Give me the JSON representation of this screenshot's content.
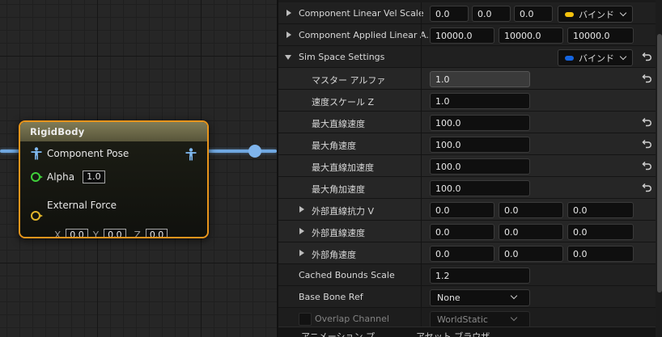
{
  "node": {
    "title": "RigidBody",
    "pose_label": "Component Pose",
    "alpha_label": "Alpha",
    "alpha_value": "1.0",
    "force_label": "External Force",
    "x_label": "X",
    "x_value": "0.0",
    "y_label": "Y",
    "y_value": "0.0",
    "z_label": "Z",
    "z_value": "0.0"
  },
  "details": {
    "rows": {
      "linear_vel_scale": {
        "label": "Component Linear Vel Scale",
        "v1": "0.0",
        "v2": "0.0",
        "v3": "0.0"
      },
      "applied_linear": {
        "label": "Component Applied Linear A...",
        "v1": "10000.0",
        "v2": "10000.0",
        "v3": "10000.0"
      },
      "sim_space": {
        "label": "Sim Space Settings"
      },
      "master_alpha": {
        "label": "マスター アルファ",
        "value": "1.0"
      },
      "vel_scale_z": {
        "label": "速度スケール Z",
        "value": "1.0"
      },
      "max_linear_vel": {
        "label": "最大直線速度",
        "value": "100.0"
      },
      "max_angular_vel": {
        "label": "最大角速度",
        "value": "100.0"
      },
      "max_linear_acc": {
        "label": "最大直線加速度",
        "value": "100.0"
      },
      "max_angular_acc": {
        "label": "最大角加速度",
        "value": "100.0"
      },
      "ext_linear_drag": {
        "label": "外部直線抗力 V",
        "v1": "0.0",
        "v2": "0.0",
        "v3": "0.0"
      },
      "ext_linear_vel": {
        "label": "外部直線速度",
        "v1": "0.0",
        "v2": "0.0",
        "v3": "0.0"
      },
      "ext_angular_vel": {
        "label": "外部角速度",
        "v1": "0.0",
        "v2": "0.0",
        "v3": "0.0"
      },
      "cached_bounds": {
        "label": "Cached Bounds Scale",
        "value": "1.2"
      },
      "base_bone": {
        "label": "Base Bone Ref",
        "value": "None"
      },
      "overlap": {
        "label": "Overlap Channel",
        "value": "WorldStatic"
      }
    },
    "bind_label": "バインド",
    "bind_colors": {
      "yellow": "#f4c20d",
      "blue": "#1565e0"
    },
    "bottom_tabs": [
      "アニメーション プ...",
      "アセット ブラウザ"
    ]
  },
  "colors": {
    "wire": "#6fa7e0",
    "node_border": "#e8951c",
    "alpha_pin": "#3fcf3a",
    "force_pin": "#e0b42a"
  }
}
